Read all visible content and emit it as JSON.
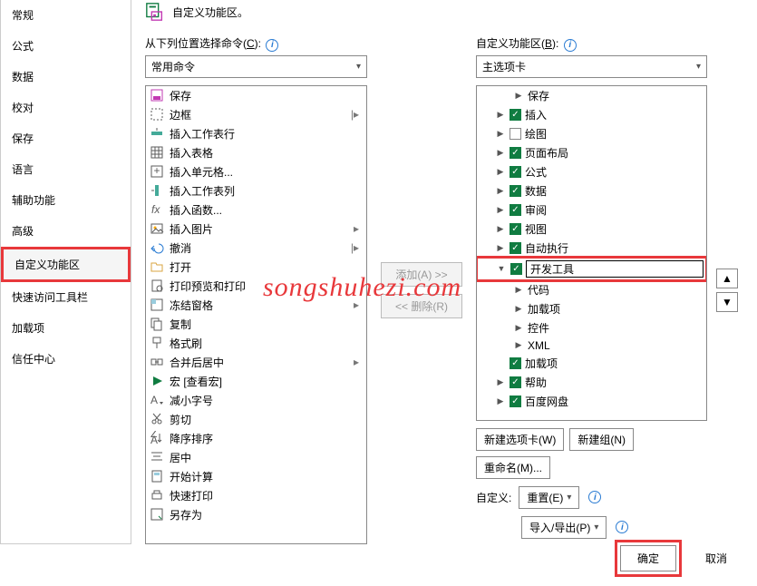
{
  "header": {
    "title": "自定义功能区。"
  },
  "sidebar": {
    "items": [
      {
        "label": "常规"
      },
      {
        "label": "公式"
      },
      {
        "label": "数据"
      },
      {
        "label": "校对"
      },
      {
        "label": "保存"
      },
      {
        "label": "语言"
      },
      {
        "label": "辅助功能"
      },
      {
        "label": "高级"
      },
      {
        "label": "自定义功能区",
        "selected": true,
        "highlight": true
      },
      {
        "label": "快速访问工具栏"
      },
      {
        "label": "加载项"
      },
      {
        "label": "信任中心"
      }
    ]
  },
  "left": {
    "label_prefix": "从下列位置选择命令(",
    "label_key": "C",
    "label_suffix": "):",
    "dropdown": "常用命令",
    "commands": [
      {
        "icon": "save",
        "label": "保存",
        "color": "#c239b3"
      },
      {
        "icon": "border",
        "label": "边框",
        "sub": "|▸"
      },
      {
        "icon": "insrow",
        "label": "插入工作表行"
      },
      {
        "icon": "table",
        "label": "插入表格"
      },
      {
        "icon": "inscell",
        "label": "插入单元格..."
      },
      {
        "icon": "inscol",
        "label": "插入工作表列"
      },
      {
        "icon": "fx",
        "label": "插入函数..."
      },
      {
        "icon": "pic",
        "label": "插入图片",
        "sub": "▸"
      },
      {
        "icon": "undo",
        "label": "撤消",
        "sub": "|▸"
      },
      {
        "icon": "open",
        "label": "打开"
      },
      {
        "icon": "preview",
        "label": "打印预览和打印"
      },
      {
        "icon": "freeze",
        "label": "冻结窗格",
        "sub": "▸"
      },
      {
        "icon": "copy",
        "label": "复制"
      },
      {
        "icon": "paint",
        "label": "格式刷"
      },
      {
        "icon": "merge",
        "label": "合并后居中",
        "sub": "▸"
      },
      {
        "icon": "macro",
        "label": "宏 [查看宏]",
        "color": "#107c41"
      },
      {
        "icon": "shrink",
        "label": "减小字号"
      },
      {
        "icon": "cut",
        "label": "剪切"
      },
      {
        "icon": "sortdesc",
        "label": "降序排序"
      },
      {
        "icon": "center",
        "label": "居中"
      },
      {
        "icon": "calc",
        "label": "开始计算"
      },
      {
        "icon": "quickprint",
        "label": "快速打印"
      },
      {
        "icon": "saveas",
        "label": "另存为"
      }
    ]
  },
  "mid": {
    "add": "添加(A) >>",
    "remove": "<< 删除(R)"
  },
  "right": {
    "label_prefix": "自定义功能区(",
    "label_key": "B",
    "label_suffix": "):",
    "dropdown": "主选项卡",
    "tree": [
      {
        "level": 2,
        "exp": ">",
        "label": "保存"
      },
      {
        "level": 1,
        "exp": ">",
        "cb": true,
        "label": "插入"
      },
      {
        "level": 1,
        "exp": ">",
        "cb": false,
        "label": "绘图"
      },
      {
        "level": 1,
        "exp": ">",
        "cb": true,
        "label": "页面布局"
      },
      {
        "level": 1,
        "exp": ">",
        "cb": true,
        "label": "公式"
      },
      {
        "level": 1,
        "exp": ">",
        "cb": true,
        "label": "数据"
      },
      {
        "level": 1,
        "exp": ">",
        "cb": true,
        "label": "审阅"
      },
      {
        "level": 1,
        "exp": ">",
        "cb": true,
        "label": "视图"
      },
      {
        "level": 1,
        "exp": ">",
        "cb": true,
        "label": "自动执行"
      },
      {
        "level": 1,
        "exp": "v",
        "cb": true,
        "label": "开发工具",
        "selected": true,
        "highlight": true
      },
      {
        "level": 2,
        "exp": ">",
        "label": "代码"
      },
      {
        "level": 2,
        "exp": ">",
        "label": "加载项"
      },
      {
        "level": 2,
        "exp": ">",
        "label": "控件"
      },
      {
        "level": 2,
        "exp": ">",
        "label": "XML"
      },
      {
        "level": 1,
        "exp": "",
        "cb": true,
        "label": "加载项"
      },
      {
        "level": 1,
        "exp": ">",
        "cb": true,
        "label": "帮助"
      },
      {
        "level": 1,
        "exp": ">",
        "cb": true,
        "label": "百度网盘"
      }
    ],
    "buttons": {
      "newtab": "新建选项卡(W)",
      "newgroup": "新建组(N)",
      "rename": "重命名(M)..."
    },
    "custom_label": "自定义:",
    "reset": "重置(E)",
    "importexport": "导入/导出(P)"
  },
  "footer": {
    "ok": "确定",
    "cancel": "取消"
  },
  "watermark": "songshuhezi.com"
}
